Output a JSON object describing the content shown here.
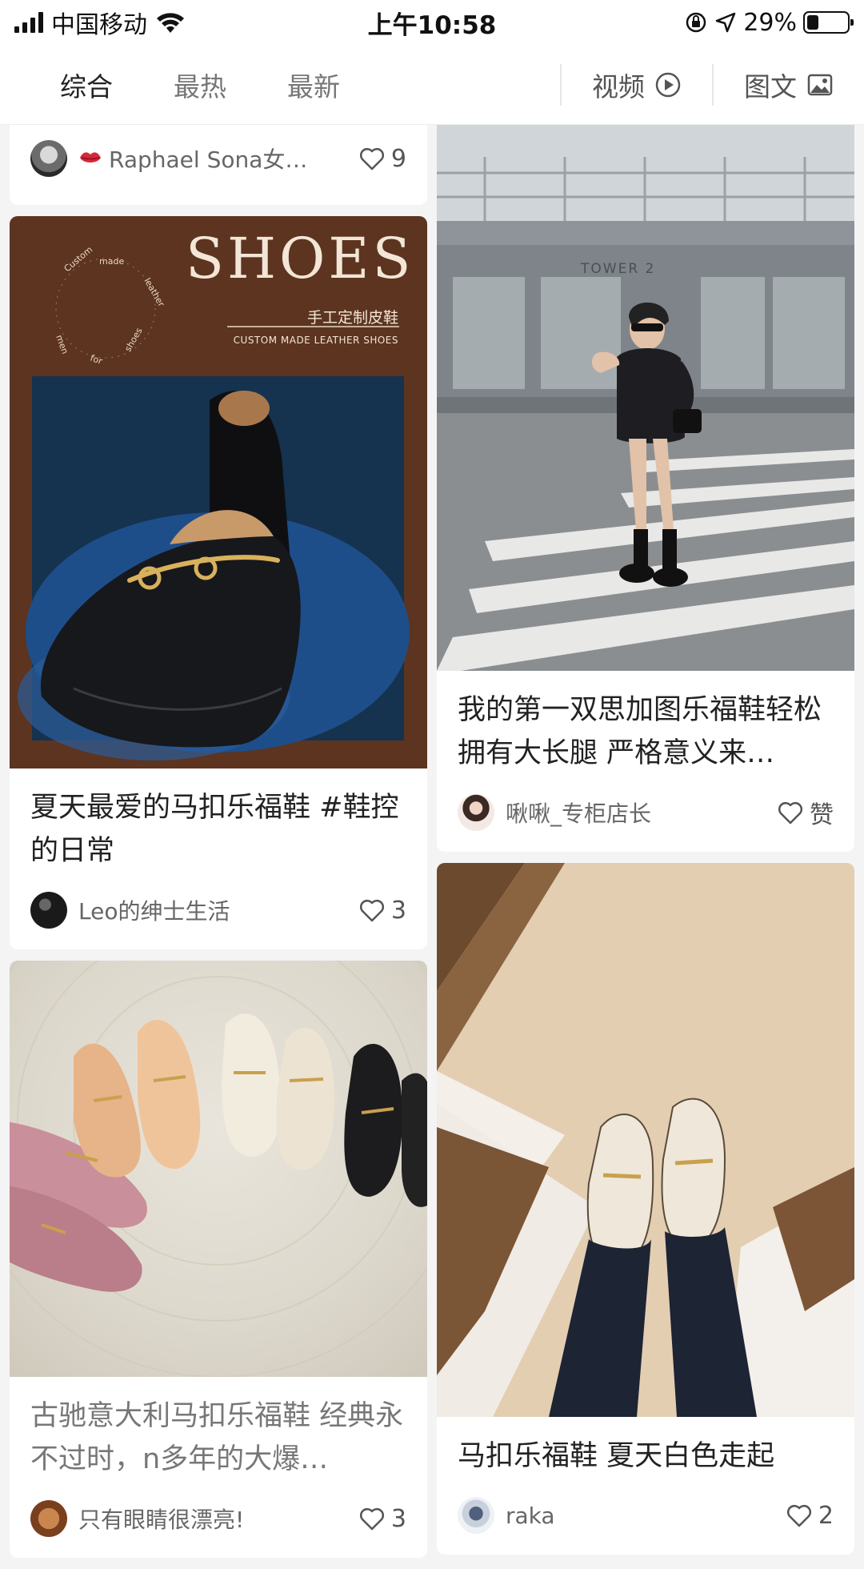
{
  "status_bar": {
    "carrier": "中国移动",
    "time": "上午10:58",
    "battery": "29%",
    "battery_level": 0.29
  },
  "tabs": {
    "items": [
      "综合",
      "最热",
      "最新"
    ],
    "active_index": 0,
    "video_label": "视频",
    "image_text_label": "图文"
  },
  "feed": {
    "left": [
      {
        "title": "",
        "author": "Raphael Sona女…",
        "likes": "9"
      },
      {
        "image_text": {
          "headline": "SHOES",
          "subtitle_cn": "手工定制皮鞋",
          "subtitle_en": "CUSTOM MADE LEATHER SHOES",
          "seal_text": "Custom · made · leather · shoes · for · men"
        },
        "title": "夏天最爱的马扣乐福鞋 #鞋控的日常",
        "author": "Leo的绅士生活",
        "likes": "3"
      },
      {
        "title": "古驰意大利马扣乐福鞋 经典永不过时，n多年的大爆…",
        "author": "只有眼睛很漂亮!",
        "likes": "3"
      }
    ],
    "right": [
      {
        "image_text": {
          "building_sign": "TOWER 2"
        },
        "title": "我的第一双思加图乐福鞋轻松拥有大长腿 严格意义来…",
        "author": "啾啾_专柜店长",
        "likes": "赞"
      },
      {
        "title": "马扣乐福鞋 夏天白色走起",
        "author": "raka",
        "likes": "2"
      }
    ]
  },
  "colors": {
    "ad_background": "#5c3420",
    "ad_text": "#f3e6d6",
    "title_text": "#222222",
    "meta_text": "#666666"
  }
}
